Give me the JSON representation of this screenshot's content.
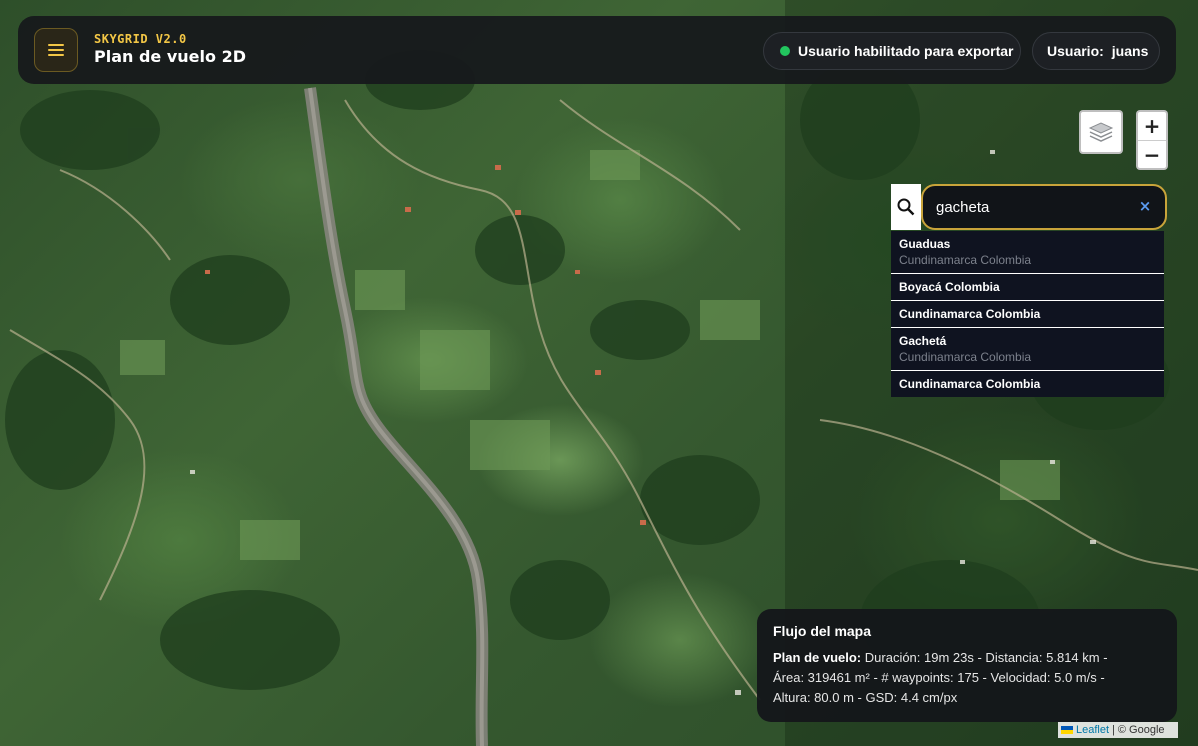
{
  "header": {
    "brand_sub": "SKYGRID V2.0",
    "brand_title": "Plan de vuelo 2D",
    "status_text": "Usuario habilitado para exportar",
    "status_color": "#22c55e",
    "user_label": "Usuario:",
    "user_name": "juans"
  },
  "map_controls": {
    "zoom_in": "+",
    "zoom_out": "−",
    "layers_icon": "layers-icon"
  },
  "search": {
    "value": "gacheta",
    "clear_glyph": "×",
    "results": [
      {
        "title": "Guaduas",
        "subtitle": "Cundinamarca Colombia"
      },
      {
        "title": "Boyacá Colombia",
        "subtitle": ""
      },
      {
        "title": "Cundinamarca Colombia",
        "subtitle": ""
      },
      {
        "title": "Gachetá",
        "subtitle": "Cundinamarca Colombia"
      },
      {
        "title": "Cundinamarca Colombia",
        "subtitle": ""
      }
    ]
  },
  "info_panel": {
    "title": "Flujo del mapa",
    "label": "Plan de vuelo:",
    "line1": "Duración: 19m 23s - Distancia: 5.814 km -",
    "line2": "Área: 319461 m² - # waypoints: 175 - Velocidad: 5.0 m/s -",
    "line3": "Altura: 80.0 m - GSD: 4.4 cm/px"
  },
  "attribution": {
    "leaflet": "Leaflet",
    "separator": "|",
    "source": "© Google"
  },
  "colors": {
    "accent": "#f3c746",
    "panel_bg": "#16181c",
    "search_border": "#c9a43a"
  }
}
